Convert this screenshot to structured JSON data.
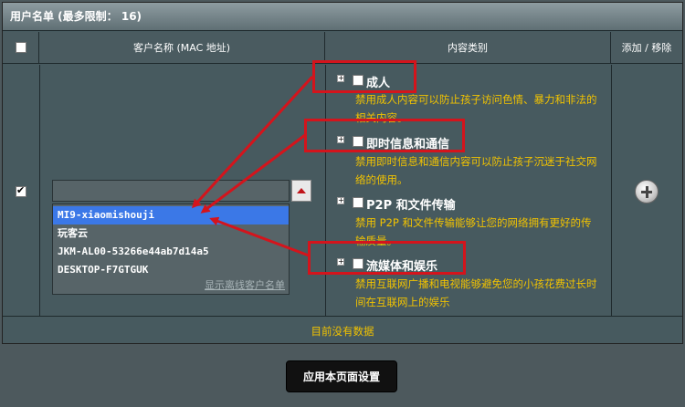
{
  "titlebar": {
    "title": "用户名单 (最多限制： 16)"
  },
  "table": {
    "columns": {
      "client_name": "客户名称 (MAC 地址)",
      "category": "内容类别",
      "add_remove": "添加 / 移除"
    }
  },
  "client_dropdown": {
    "options": [
      "MI9-xiaomishouji",
      "玩客云",
      "JKM-AL00-53266e44ab7d14a5",
      "DESKTOP-F7GTGUK"
    ],
    "selected": "MI9-xiaomishouji",
    "show_offline_link": "显示离线客户名单"
  },
  "categories": [
    {
      "label": "成人",
      "desc_line1": "禁用成人内容可以防止孩子访问色情、暴力和非法的",
      "desc_line2": "相关内容。"
    },
    {
      "label": "即时信息和通信",
      "desc_line1": "禁用即时信息和通信内容可以防止孩子沉迷于社交网",
      "desc_line2": "络的使用。"
    },
    {
      "label": "P2P 和文件传输",
      "desc_line1": "禁用 P2P 和文件传输能够让您的网络拥有更好的传",
      "desc_line2": "输质量。"
    },
    {
      "label": "流媒体和娱乐",
      "desc_line1": "禁用互联网广播和电视能够避免您的小孩花费过长时",
      "desc_line2": "间在互联网上的娱乐"
    }
  ],
  "footer": {
    "no_data": "目前没有数据"
  },
  "actions": {
    "apply_label": "应用本页面设置"
  },
  "colors": {
    "annotation": "#d4141c",
    "description": "#f2c300",
    "selected": "#3b78e7"
  }
}
